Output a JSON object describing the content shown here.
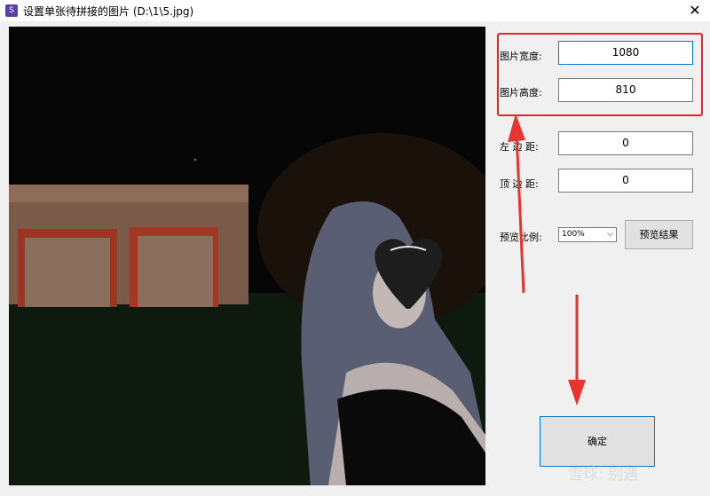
{
  "window": {
    "title": "设置单张待拼接的图片  (D:\\1\\5.jpg)",
    "close_glyph": "✕",
    "app_icon_glyph": "S"
  },
  "fields": {
    "width_label": "图片宽度:",
    "width_value": "1080",
    "height_label": "图片高度:",
    "height_value": "810",
    "left_margin_label": "左 边 距:",
    "left_margin_value": "0",
    "top_margin_label": "顶 边 距:",
    "top_margin_value": "0"
  },
  "preview": {
    "ratio_label": "预览比例:",
    "ratio_value": "100%",
    "preview_button": "预览结果"
  },
  "confirm_button": "确定",
  "watermark": "雪球: 别遇",
  "colors": {
    "highlight_red": "#e6262d",
    "arrow_red": "#e8332f",
    "focus_blue": "#0078d7"
  }
}
